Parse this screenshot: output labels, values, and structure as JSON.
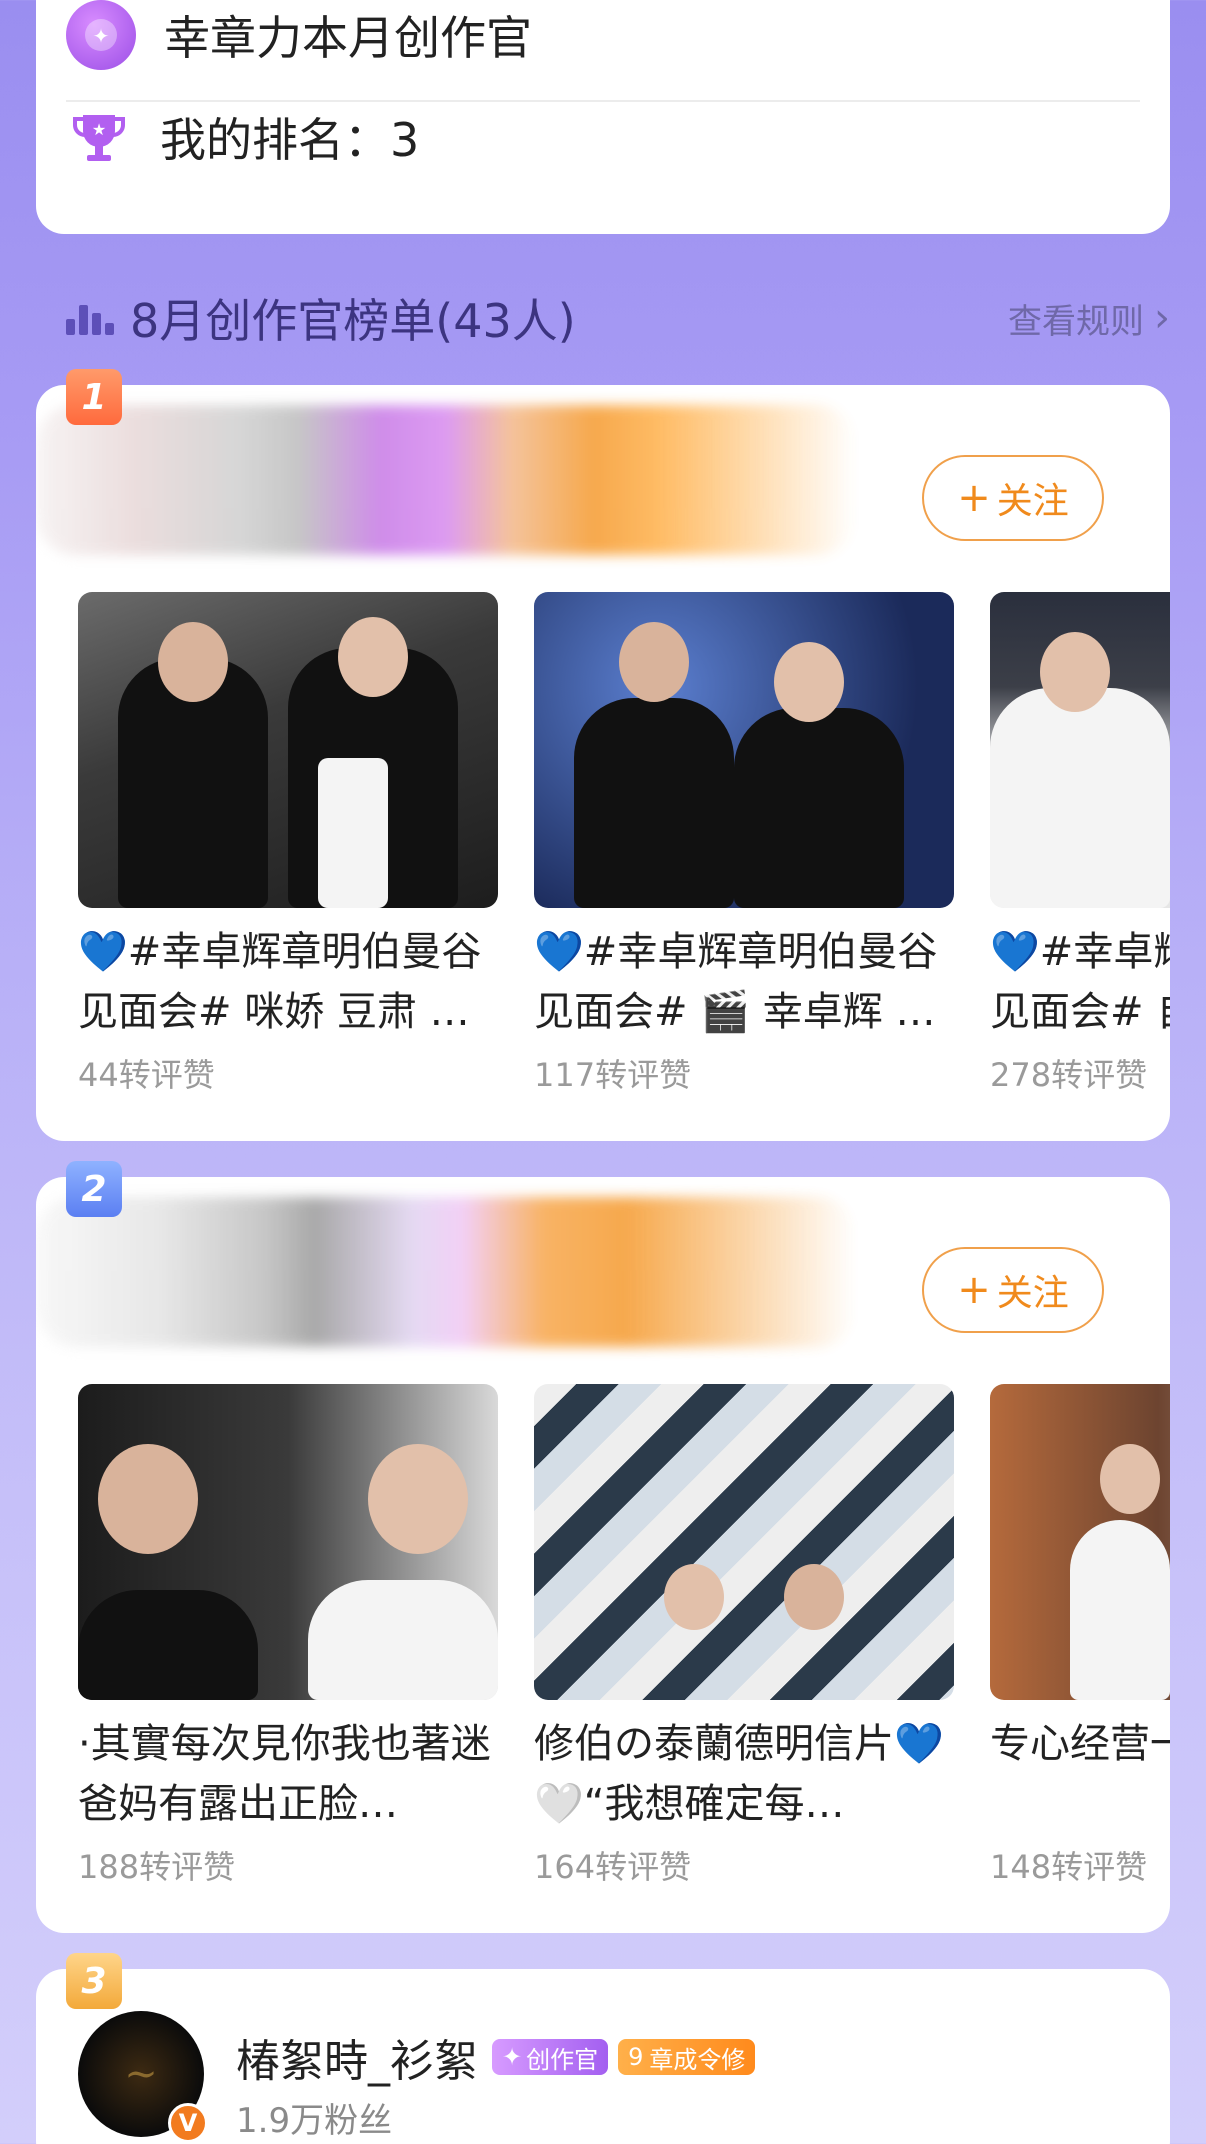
{
  "info_card": {
    "title": "幸章力本月创作官",
    "rank_label": "我的排名：3"
  },
  "ranking": {
    "title": "8月创作官榜单(43人)",
    "rules_label": "查看规则"
  },
  "creators": [
    {
      "rank": "1",
      "follow_label": "关注",
      "posts": [
        {
          "caption": "💙#幸卓辉章明伯曼谷见面会# 咪娇 豆肃 …",
          "stats": "44转评赞"
        },
        {
          "caption": "💙#幸卓辉章明伯曼谷见面会# 🎬 幸卓辉 …",
          "stats": "117转评赞"
        },
        {
          "caption": "💙#幸卓辉章明伯曼谷见面会# 自",
          "stats": "278转评赞"
        }
      ]
    },
    {
      "rank": "2",
      "follow_label": "关注",
      "posts": [
        {
          "caption": "·其實每次見你我也著迷 爸妈有露出正脸…",
          "stats": "188转评赞"
        },
        {
          "caption": "修伯の泰蘭德明信片💙🤍“我想確定每…",
          "stats": "164转评赞"
        },
        {
          "caption": "专心经营一萌生活🐽",
          "stats": "148转评赞"
        }
      ]
    },
    {
      "rank": "3",
      "name": "椿絮時_衫絮",
      "tag_creator": "创作官",
      "tag_level": "9",
      "tag_title": "章成令修",
      "fans": "1.9万粉丝",
      "verified": "V"
    }
  ],
  "icons": {
    "plus": "+",
    "chevron": "›"
  },
  "colors": {
    "accent": "#f08a1c",
    "header_text": "#3c3480"
  }
}
